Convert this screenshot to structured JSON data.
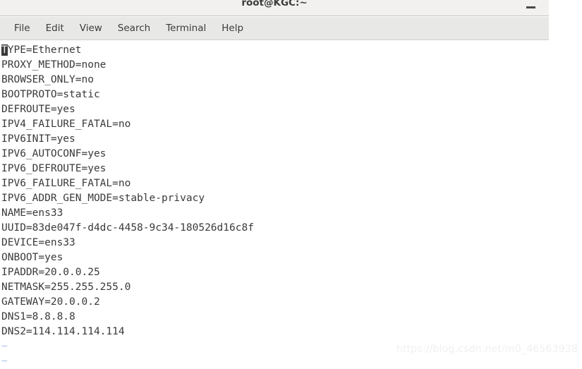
{
  "window": {
    "title": "root@KGC:~",
    "minimize_icon": "minimize-icon",
    "minimize_label": "_"
  },
  "menu": {
    "items": [
      {
        "label": "File"
      },
      {
        "label": "Edit"
      },
      {
        "label": "View"
      },
      {
        "label": "Search"
      },
      {
        "label": "Terminal"
      },
      {
        "label": "Help"
      }
    ]
  },
  "terminal": {
    "cursor_char": "T",
    "first_line_rest": "YPE=Ethernet",
    "lines": [
      "PROXY_METHOD=none",
      "BROWSER_ONLY=no",
      "BOOTPROTO=static",
      "DEFROUTE=yes",
      "IPV4_FAILURE_FATAL=no",
      "IPV6INIT=yes",
      "IPV6_AUTOCONF=yes",
      "IPV6_DEFROUTE=yes",
      "IPV6_FAILURE_FATAL=no",
      "IPV6_ADDR_GEN_MODE=stable-privacy",
      "NAME=ens33",
      "UUID=83de047f-d4dc-4458-9c34-180526d16c8f",
      "DEVICE=ens33",
      "ONBOOT=yes",
      "IPADDR=20.0.0.25",
      "NETMASK=255.255.255.0",
      "GATEWAY=20.0.0.2",
      "DNS1=8.8.8.8",
      "DNS2=114.114.114.114"
    ],
    "empty_markers": [
      "~",
      "~"
    ]
  },
  "watermark": {
    "text": "https://blog.csdn.net/m0_46563938"
  },
  "colors": {
    "titlebar_bg": "#f2f1f0",
    "menubar_bg": "#e8e8e6",
    "terminal_bg": "#ffffff",
    "terminal_fg": "#3a3a3a",
    "tilde_fg": "#a8c2e8",
    "watermark_fg": "#f0f0f0"
  }
}
